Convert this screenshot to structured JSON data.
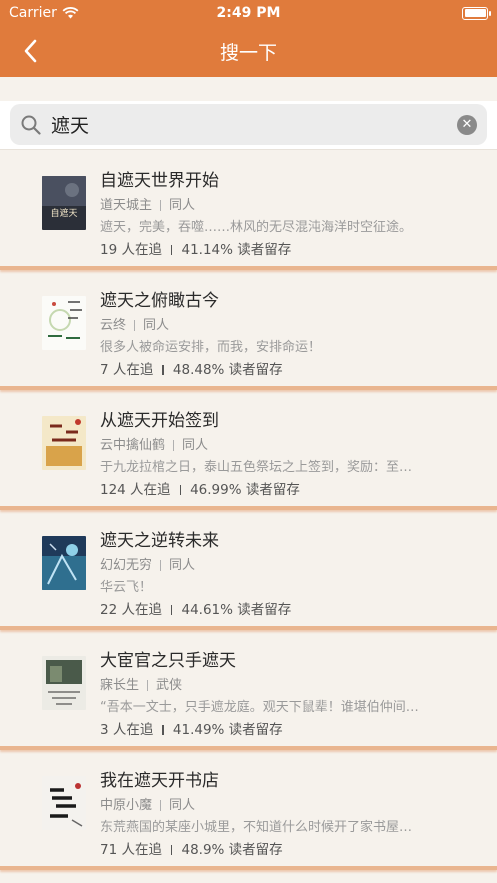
{
  "status_bar": {
    "carrier": "Carrier",
    "time": "2:49 PM"
  },
  "nav": {
    "title": "搜一下"
  },
  "search": {
    "value": "遮天"
  },
  "colors": {
    "accent": "#e07b3c",
    "background": "#f6f2ec"
  },
  "books": [
    {
      "title": "自遮天世界开始",
      "author": "道天城主",
      "category": "同人",
      "desc": "遮天，完美，吞噬……林风的无尽混沌海洋时空征途。",
      "followers": "19 人在追",
      "retention": "41.14% 读者留存",
      "cover_text": "自遮天"
    },
    {
      "title": "遮天之俯瞰古今",
      "author": "云终",
      "category": "同人",
      "desc": "很多人被命运安排，而我，安排命运！",
      "followers": "7 人在追",
      "retention": "48.48% 读者留存",
      "cover_text": ""
    },
    {
      "title": "从遮天开始签到",
      "author": "云中擒仙鹤",
      "category": "同人",
      "desc": "于九龙拉棺之日，泰山五色祭坛之上签到，奖励：至…",
      "followers": "124 人在追",
      "retention": "46.99% 读者留存",
      "cover_text": ""
    },
    {
      "title": "遮天之逆转未来",
      "author": "幻幻无穷",
      "category": "同人",
      "desc": "华云飞！",
      "followers": "22 人在追",
      "retention": "44.61% 读者留存",
      "cover_text": ""
    },
    {
      "title": "大宦官之只手遮天",
      "author": "寐长生",
      "category": "武侠",
      "desc": "“吾本一文士，只手遮龙庭。观天下鼠辈！谁堪伯仲间…",
      "followers": "3 人在追",
      "retention": "41.49% 读者留存",
      "cover_text": ""
    },
    {
      "title": "我在遮天开书店",
      "author": "中原小魔",
      "category": "同人",
      "desc": "东荒燕国的某座小城里，不知道什么时候开了家书屋…",
      "followers": "71 人在追",
      "retention": "48.9% 读者留存",
      "cover_text": ""
    }
  ]
}
